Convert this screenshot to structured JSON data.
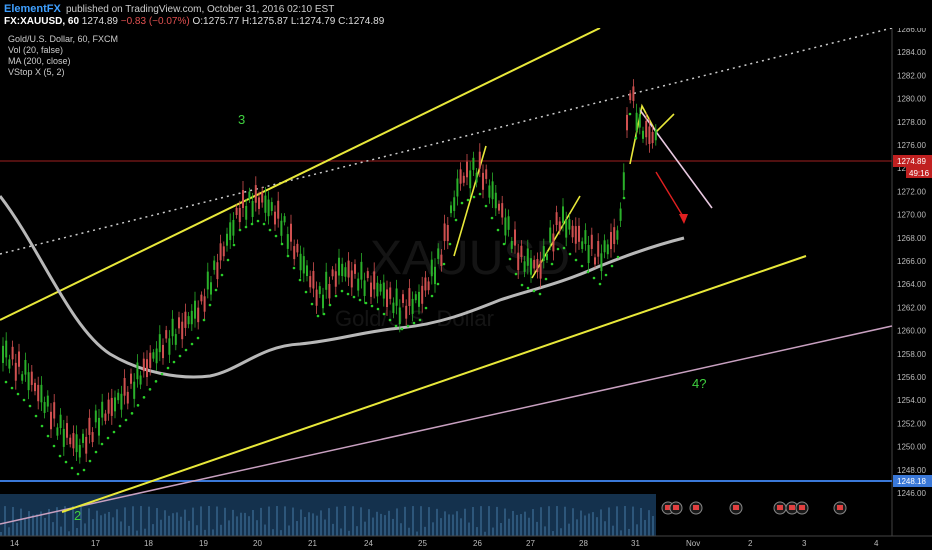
{
  "header": {
    "brand": "ElementFX",
    "published": "published on TradingView.com, October 31, 2016 02:10 EST",
    "symbol": "FX:XAUUSD, 60",
    "last": "1274.89",
    "change": "−0.83 (−0.07%)",
    "ohlc": "O:1275.77 H:1275.87 L:1274.79 C:1274.89"
  },
  "legend": {
    "title": "Gold/U.S. Dollar, 60, FXCM",
    "indicators": [
      "Vol (20, false)",
      "MA (200, close)",
      "VStop X (5, 2)"
    ]
  },
  "watermark": {
    "symbol": "XAUUSD",
    "name": "Gold/U.S. Dollar"
  },
  "price_axis": {
    "ticks": [
      "1286.00",
      "1284.00",
      "1282.00",
      "1280.00",
      "1278.00",
      "1276.00",
      "1274.00",
      "1272.00",
      "1270.00",
      "1268.00",
      "1266.00",
      "1264.00",
      "1262.00",
      "1260.00",
      "1258.00",
      "1256.00",
      "1254.00",
      "1252.00",
      "1250.00",
      "1248.00",
      "1246.00"
    ],
    "last_price_tag": "1274.89",
    "countdown_tag": "49:16",
    "level_tag": "1248.18"
  },
  "time_axis": {
    "ticks": [
      "14",
      "17",
      "18",
      "19",
      "20",
      "21",
      "24",
      "25",
      "26",
      "27",
      "28",
      "31",
      "Nov",
      "2",
      "3",
      "4"
    ]
  },
  "wave_labels": [
    "3",
    "2",
    "4?"
  ],
  "colors": {
    "trendline": "#e8e83a",
    "ma": "#b8b8b8",
    "stop_dots": "#2ad02a",
    "support_line": "#3a78d8",
    "pink_line": "#c8a0c0",
    "last_price_line": "#a02020",
    "arrow": "#e02020",
    "volume": "#1f4f7a"
  },
  "event_icons": [
    "calendar-flag",
    "calendar-flag",
    "calendar-flag",
    "calendar-flag",
    "calendar-flag",
    "calendar-flag",
    "calendar-flag",
    "calendar-flag"
  ]
}
